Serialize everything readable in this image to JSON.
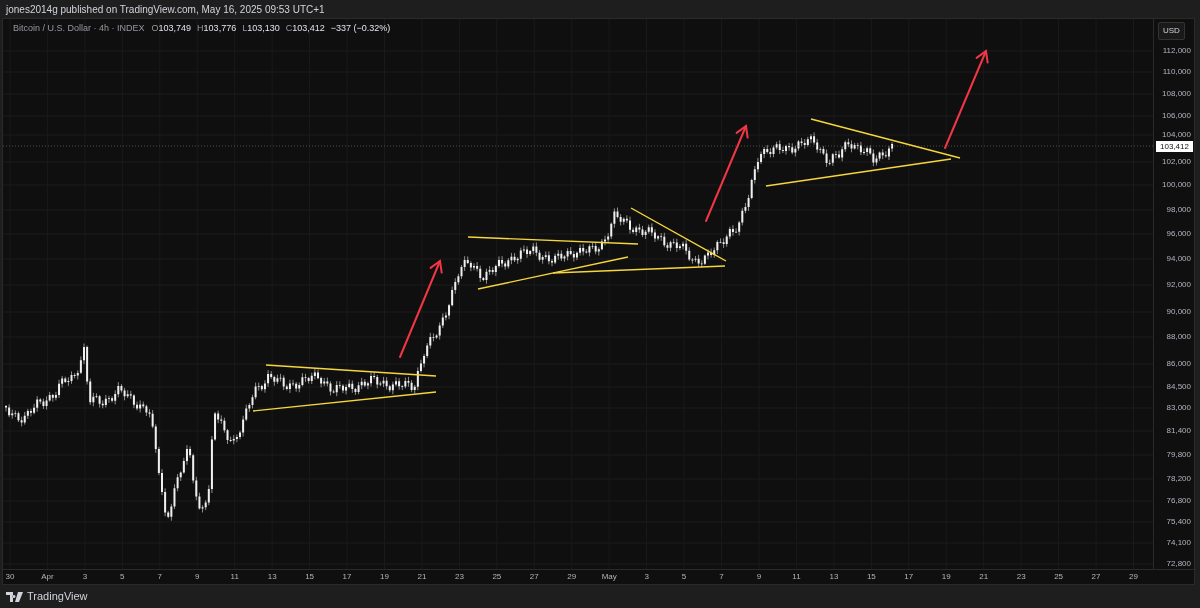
{
  "header": {
    "publisher": "jones2014g published on TradingView.com, May 16, 2025 09:53 UTC+1"
  },
  "legend": {
    "symbol": "Bitcoin / U.S. Dollar · 4h · INDEX",
    "ohlc": [
      {
        "label": "O",
        "value": "103,749"
      },
      {
        "label": "H",
        "value": "103,776"
      },
      {
        "label": "L",
        "value": "103,130"
      },
      {
        "label": "C",
        "value": "103,412"
      }
    ],
    "change": "−337 (−0.32%)"
  },
  "price_axis": {
    "currency": "USD",
    "last_price": "103,412",
    "ticks": [
      "112,000",
      "110,000",
      "108,000",
      "106,000",
      "104,000",
      "102,000",
      "100,000",
      "98,000",
      "96,000",
      "94,000",
      "92,000",
      "90,000",
      "88,000",
      "86,000",
      "84,500",
      "83,000",
      "81,400",
      "79,800",
      "78,200",
      "76,800",
      "75,400",
      "74,100",
      "72,800"
    ]
  },
  "time_axis": {
    "ticks": [
      "30",
      "Apr",
      "3",
      "5",
      "7",
      "9",
      "11",
      "13",
      "15",
      "17",
      "19",
      "21",
      "23",
      "25",
      "27",
      "29",
      "May",
      "3",
      "5",
      "7",
      "9",
      "11",
      "13",
      "15",
      "17",
      "19",
      "21",
      "23",
      "25",
      "27",
      "29"
    ]
  },
  "footer": {
    "logo_text": "TradingView"
  }
}
